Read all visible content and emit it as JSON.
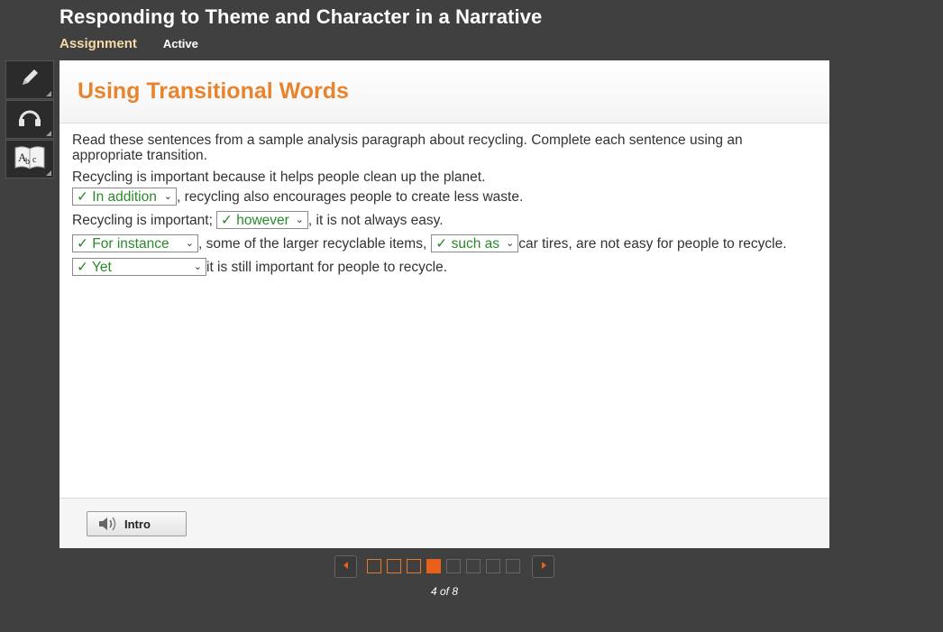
{
  "header": {
    "title": "Responding to Theme and Character in a Narrative",
    "assignment_label": "Assignment",
    "status": "Active"
  },
  "toolbar": {
    "tools": [
      {
        "icon": "pencil-icon"
      },
      {
        "icon": "headphones-icon"
      },
      {
        "icon": "dictionary-icon",
        "glyph": "Abc"
      }
    ]
  },
  "panel": {
    "title": "Using Transitional Words",
    "instructions": "Read these sentences from a sample analysis paragraph about recycling. Complete each sentence using an appropriate transition.",
    "sentence1": "Recycling is important because it helps people clean up the planet.",
    "line2": {
      "select": "✓ In addition",
      "after": ", recycling also encourages people to create less waste."
    },
    "line3": {
      "before": "Recycling is important;",
      "select": "✓ however",
      "after": ", it is not always easy."
    },
    "line4": {
      "select1": "✓ For instance",
      "middle": ", some of the larger recyclable items,",
      "select2": "✓ such as",
      "after": "car tires, are not easy for people to recycle."
    },
    "line5": {
      "select": "✓ Yet",
      "after": "it is still important for people to recycle."
    },
    "correct_color": "#2a8a2a",
    "title_color": "#e8842e"
  },
  "footer": {
    "intro_label": "Intro"
  },
  "pager": {
    "current": 4,
    "total": 8,
    "label": "4 of 8"
  }
}
